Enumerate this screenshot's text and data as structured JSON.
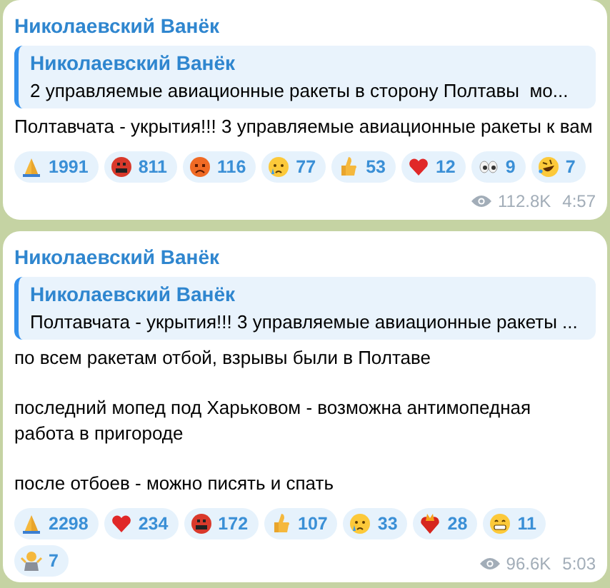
{
  "posts": [
    {
      "author": "Николаевский Ванёк",
      "reply": {
        "author": "Николаевский Ванёк",
        "text": "2 управляемые авиационные ракеты в сторону Полтавы  мо..."
      },
      "paragraphs": [
        "Полтавчата - укрытия!!! 3 управляемые авиационные ракеты к вам"
      ],
      "reactions": [
        {
          "kind": "pray",
          "count": "1991"
        },
        {
          "kind": "cursing",
          "count": "811"
        },
        {
          "kind": "angry",
          "count": "116"
        },
        {
          "kind": "cry",
          "count": "77"
        },
        {
          "kind": "thumbs",
          "count": "53"
        },
        {
          "kind": "heart",
          "count": "12"
        },
        {
          "kind": "eyes",
          "count": "9"
        },
        {
          "kind": "rofl",
          "count": "7"
        }
      ],
      "views": "112.8K",
      "time": "4:57"
    },
    {
      "author": "Николаевский Ванёк",
      "reply": {
        "author": "Николаевский Ванёк",
        "text": "Полтавчата - укрытия!!! 3 управляемые авиационные ракеты ..."
      },
      "paragraphs": [
        "по всем ракетам отбой, взрывы были в Полтаве",
        "последний мопед под Харьковом - возможна антимопедная работа в пригороде",
        "после отбоев - можно писять и спать"
      ],
      "reactions": [
        {
          "kind": "pray",
          "count": "2298"
        },
        {
          "kind": "heart",
          "count": "234"
        },
        {
          "kind": "cursing",
          "count": "172"
        },
        {
          "kind": "thumbs",
          "count": "107"
        },
        {
          "kind": "cry",
          "count": "33"
        },
        {
          "kind": "heart-fire",
          "count": "28"
        },
        {
          "kind": "grin",
          "count": "11"
        },
        {
          "kind": "shrug",
          "count": "7"
        }
      ],
      "views": "96.6K",
      "time": "5:03"
    }
  ]
}
